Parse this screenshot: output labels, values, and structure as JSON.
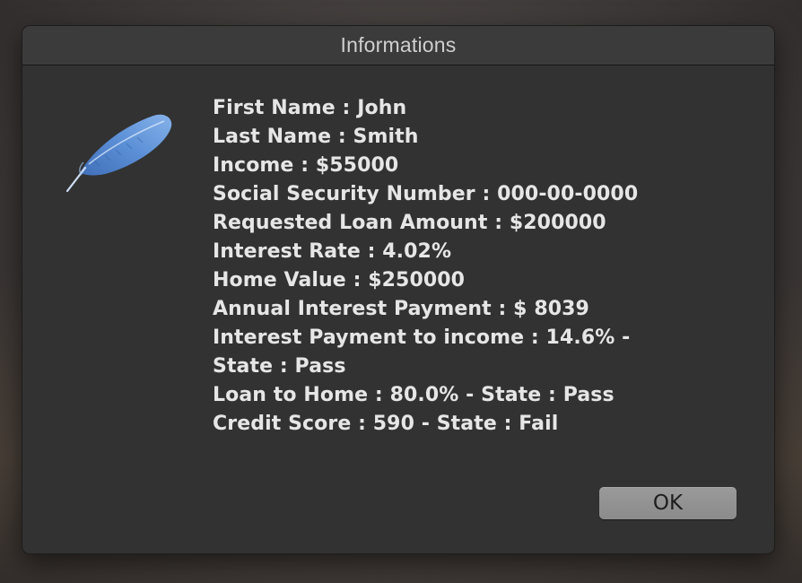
{
  "dialog": {
    "title": "Informations",
    "icon": "feather-icon",
    "lines": [
      "First Name : John",
      "Last Name : Smith",
      "Income : $55000",
      "Social Security Number : 000-00-0000",
      "Requested Loan Amount : $200000",
      "Interest Rate : 4.02%",
      "Home Value : $250000",
      "Annual Interest Payment : $ 8039",
      "Interest Payment to income : 14.6% -",
      "State : Pass",
      "Loan to Home : 80.0% - State : Pass",
      "Credit Score : 590 - State : Fail"
    ],
    "ok_label": "OK"
  },
  "colors": {
    "dialog_background": "#323232",
    "text": "#e6e6e6",
    "button": "#8f8f8f",
    "feather": "#5b8fd6"
  }
}
